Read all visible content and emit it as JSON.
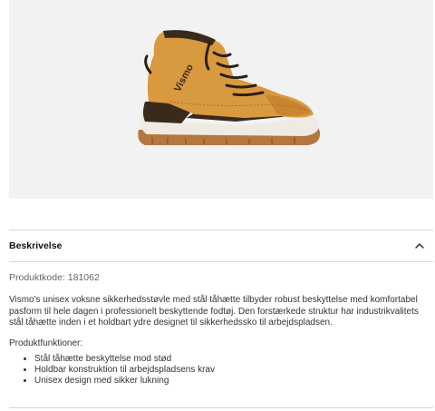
{
  "product": {
    "image_alt": "Vismo boot",
    "brand_mark": "Vismo"
  },
  "accordion": {
    "title": "Beskrivelse",
    "expanded": true
  },
  "description": {
    "product_code": "Produktkode: 181062",
    "text": "Vismo's unisex voksne sikkerhedsstøvle med stål tåhætte tilbyder robust beskyttelse med komfortabel pasform til hele dagen i professionelt beskyttende fodtøj. Den forstærkede struktur har industrikvalitets stål tåhætte inden i et holdbart ydre designet til sikkerhedssko til arbejdspladsen.",
    "features_title": "Produktfunktioner:",
    "features": [
      "Stål tåhætte beskyttelse mod stød",
      "Holdbar konstruktion til arbejdspladsens krav",
      "Unisex design med sikker lukning"
    ]
  },
  "icons": {
    "accordion_toggle": "chevron-up-icon"
  },
  "colors": {
    "boot_leather": "#d99a3f",
    "boot_dark": "#3a2a1e",
    "sole_white": "#efeae2",
    "sole_brown": "#b5773e",
    "image_bg": "#f2f2f2"
  }
}
